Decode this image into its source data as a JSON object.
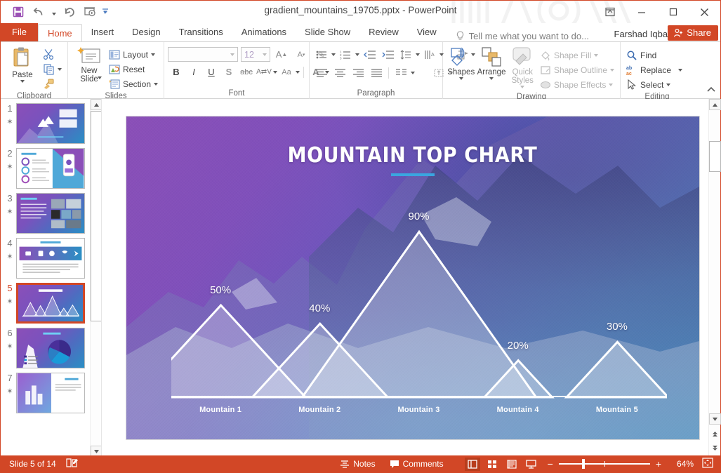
{
  "window": {
    "title": "gradient_mountains_19705.pptx - PowerPoint",
    "quick_access": [
      {
        "name": "save",
        "label": "Save"
      },
      {
        "name": "undo",
        "label": "Undo"
      },
      {
        "name": "redo",
        "label": "Repeat"
      },
      {
        "name": "start-slideshow",
        "label": "Start From Beginning"
      },
      {
        "name": "customize-qat",
        "label": "Customize Quick Access Toolbar"
      }
    ],
    "controls": [
      {
        "name": "ribbon-display-options",
        "label": "Ribbon Display Options"
      },
      {
        "name": "minimize",
        "label": "Minimize"
      },
      {
        "name": "restore",
        "label": "Restore Down"
      },
      {
        "name": "close",
        "label": "Close"
      }
    ]
  },
  "tabs": {
    "file": "File",
    "items": [
      "Home",
      "Insert",
      "Design",
      "Transitions",
      "Animations",
      "Slide Show",
      "Review",
      "View"
    ],
    "active": "Home",
    "tellme_placeholder": "Tell me what you want to do...",
    "user": "Farshad Iqbal",
    "share": "Share"
  },
  "ribbon": {
    "groups": [
      {
        "name": "clipboard",
        "label": "Clipboard",
        "big": [
          {
            "label": "Paste",
            "has_caret": true
          }
        ],
        "small": [
          {
            "label": "Cut"
          },
          {
            "label": "Copy",
            "has_caret": true
          },
          {
            "label": "Format Painter"
          }
        ]
      },
      {
        "name": "slides",
        "label": "Slides",
        "big": [
          {
            "label": "New\nSlide",
            "has_caret": true
          }
        ],
        "small": [
          {
            "label": "Layout",
            "has_caret": true
          },
          {
            "label": "Reset",
            "has_caret": false
          },
          {
            "label": "Section",
            "has_caret": true
          }
        ]
      },
      {
        "name": "font",
        "label": "Font",
        "font_name": "",
        "font_size": "12",
        "buttons": [
          "Bold",
          "Italic",
          "Underline",
          "Text Shadow",
          "Strikethrough",
          "Character Spacing",
          "Change Case",
          "Font Color"
        ]
      },
      {
        "name": "paragraph",
        "label": "Paragraph",
        "buttons": [
          "Bullets",
          "Numbering",
          "Decrease List Level",
          "Increase List Level",
          "Line Spacing",
          "Text Direction",
          "Align Text",
          "Convert to SmartArt",
          "Align Left",
          "Center",
          "Align Right",
          "Justify",
          "Columns"
        ]
      },
      {
        "name": "drawing",
        "label": "Drawing",
        "big": [
          {
            "label": "Shapes",
            "has_caret": true
          },
          {
            "label": "Arrange",
            "has_caret": true
          },
          {
            "label": "Quick\nStyles",
            "has_caret": true
          }
        ],
        "small": [
          {
            "label": "Shape Fill",
            "has_caret": true
          },
          {
            "label": "Shape Outline",
            "has_caret": true
          },
          {
            "label": "Shape Effects",
            "has_caret": true
          }
        ]
      },
      {
        "name": "editing",
        "label": "Editing",
        "small": [
          {
            "label": "Find"
          },
          {
            "label": "Replace",
            "has_caret": true
          },
          {
            "label": "Select",
            "has_caret": true
          }
        ]
      }
    ]
  },
  "thumbnails": [
    {
      "number": "1",
      "kind": "title",
      "selected": false
    },
    {
      "number": "2",
      "kind": "features",
      "selected": false
    },
    {
      "number": "3",
      "kind": "gallery",
      "selected": false
    },
    {
      "number": "4",
      "kind": "icons",
      "selected": false
    },
    {
      "number": "5",
      "kind": "mountains",
      "selected": true
    },
    {
      "number": "6",
      "kind": "pie",
      "selected": false
    },
    {
      "number": "7",
      "kind": "bars",
      "selected": false
    }
  ],
  "slide": {
    "title": "MOUNTAIN TOP CHART",
    "accent_color": "#3aa6e0",
    "bg_from": "#8b4fb8",
    "bg_to": "#2380b9"
  },
  "chart_data": {
    "type": "bar",
    "title": "MOUNTAIN TOP CHART",
    "xlabel": "",
    "ylabel": "",
    "ylim": [
      0,
      100
    ],
    "grid": false,
    "legend": "none",
    "categories": [
      "Mountain 1",
      "Mountain 2",
      "Mountain 3",
      "Mountain 4",
      "Mountain 5"
    ],
    "values": [
      50,
      40,
      90,
      20,
      30
    ],
    "value_labels": [
      "50%",
      "40%",
      "90%",
      "20%",
      "30%"
    ],
    "marker_style": "triangle-peak",
    "series": [
      {
        "name": "Mountain Top Chart",
        "values": [
          50,
          40,
          90,
          20,
          30
        ]
      }
    ]
  },
  "statusbar": {
    "slide_counter": "Slide 5 of 14",
    "notes": "Notes",
    "comments": "Comments",
    "zoom": "64%",
    "views": [
      {
        "name": "normal",
        "label": "Normal",
        "selected": true
      },
      {
        "name": "slide-sorter",
        "label": "Slide Sorter",
        "selected": false
      },
      {
        "name": "reading-view",
        "label": "Reading View",
        "selected": false
      },
      {
        "name": "slide-show",
        "label": "Slide Show",
        "selected": false
      }
    ],
    "zoom_out": "−",
    "zoom_in": "+",
    "fit_label": "Fit slide to current window"
  }
}
